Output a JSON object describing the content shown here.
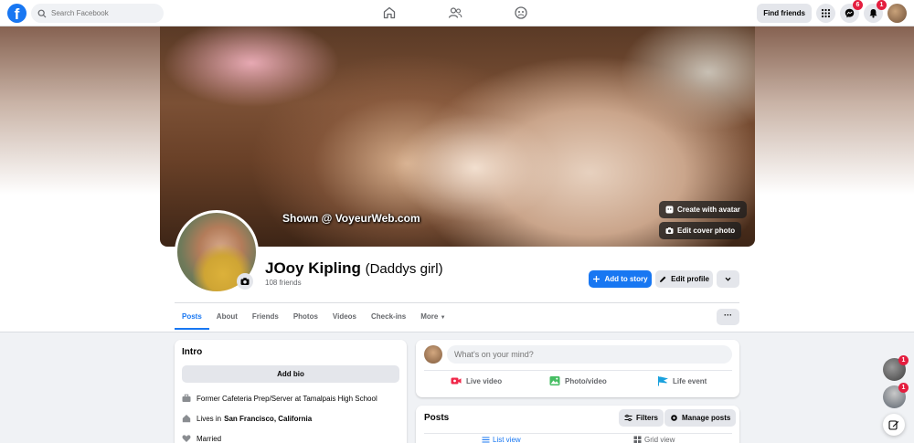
{
  "nav": {
    "logo": "f",
    "search_placeholder": "Search Facebook",
    "find_friends": "Find friends",
    "messenger_badge": "6",
    "notifications_badge": "1"
  },
  "cover": {
    "watermark": "Shown @ VoyeurWeb.com",
    "create_avatar": "Create with avatar",
    "edit_cover": "Edit cover photo"
  },
  "profile": {
    "name": "JOoy Kipling",
    "nickname": "(Daddys girl)",
    "friends": "108 friends",
    "add_story": "Add to story",
    "edit_profile": "Edit profile"
  },
  "tabs": [
    "Posts",
    "About",
    "Friends",
    "Photos",
    "Videos",
    "Check-ins",
    "More"
  ],
  "more_dots": "···",
  "intro": {
    "title": "Intro",
    "add_bio": "Add bio",
    "work": "Former Cafeteria Prep/Server at Tamalpais High School",
    "lives_prefix": "Lives in",
    "lives_city": "San Francisco, California",
    "relationship": "Married"
  },
  "composer": {
    "placeholder": "What's on your mind?",
    "live": "Live video",
    "photo": "Photo/video",
    "life": "Life event"
  },
  "posts": {
    "title": "Posts",
    "filters": "Filters",
    "manage": "Manage posts",
    "list_view": "List view",
    "grid_view": "Grid view"
  },
  "chat": {
    "badge1": "1",
    "badge2": "1"
  },
  "colors": {
    "brand_blue": "#1877f2",
    "badge_red": "#e41e3f",
    "page_bg": "#f0f2f5"
  }
}
